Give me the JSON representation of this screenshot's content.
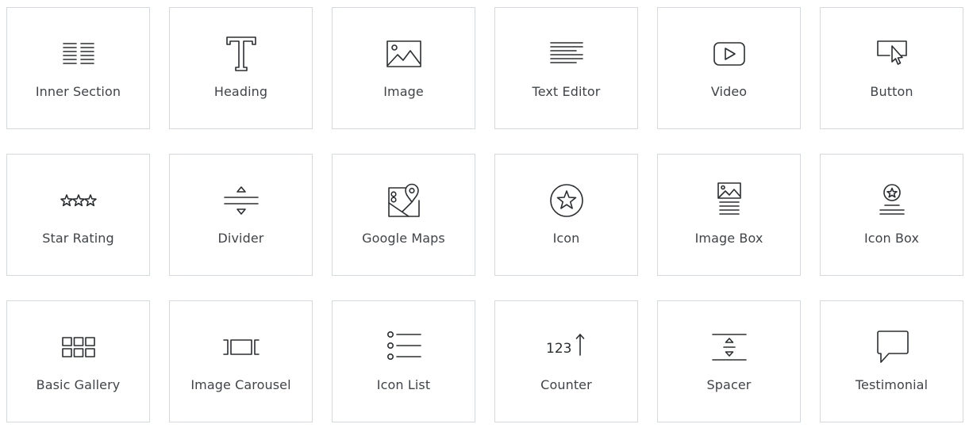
{
  "widgets": [
    {
      "label": "Inner Section",
      "icon": "inner-section-icon"
    },
    {
      "label": "Heading",
      "icon": "heading-icon"
    },
    {
      "label": "Image",
      "icon": "image-icon"
    },
    {
      "label": "Text Editor",
      "icon": "text-editor-icon"
    },
    {
      "label": "Video",
      "icon": "video-icon"
    },
    {
      "label": "Button",
      "icon": "button-icon"
    },
    {
      "label": "Star Rating",
      "icon": "star-rating-icon"
    },
    {
      "label": "Divider",
      "icon": "divider-icon"
    },
    {
      "label": "Google Maps",
      "icon": "google-maps-icon"
    },
    {
      "label": "Icon",
      "icon": "icon-icon"
    },
    {
      "label": "Image Box",
      "icon": "image-box-icon"
    },
    {
      "label": "Icon Box",
      "icon": "icon-box-icon"
    },
    {
      "label": "Basic Gallery",
      "icon": "basic-gallery-icon"
    },
    {
      "label": "Image Carousel",
      "icon": "image-carousel-icon"
    },
    {
      "label": "Icon List",
      "icon": "icon-list-icon"
    },
    {
      "label": "Counter",
      "icon": "counter-icon",
      "icon_text": "123"
    },
    {
      "label": "Spacer",
      "icon": "spacer-icon"
    },
    {
      "label": "Testimonial",
      "icon": "testimonial-icon"
    }
  ]
}
